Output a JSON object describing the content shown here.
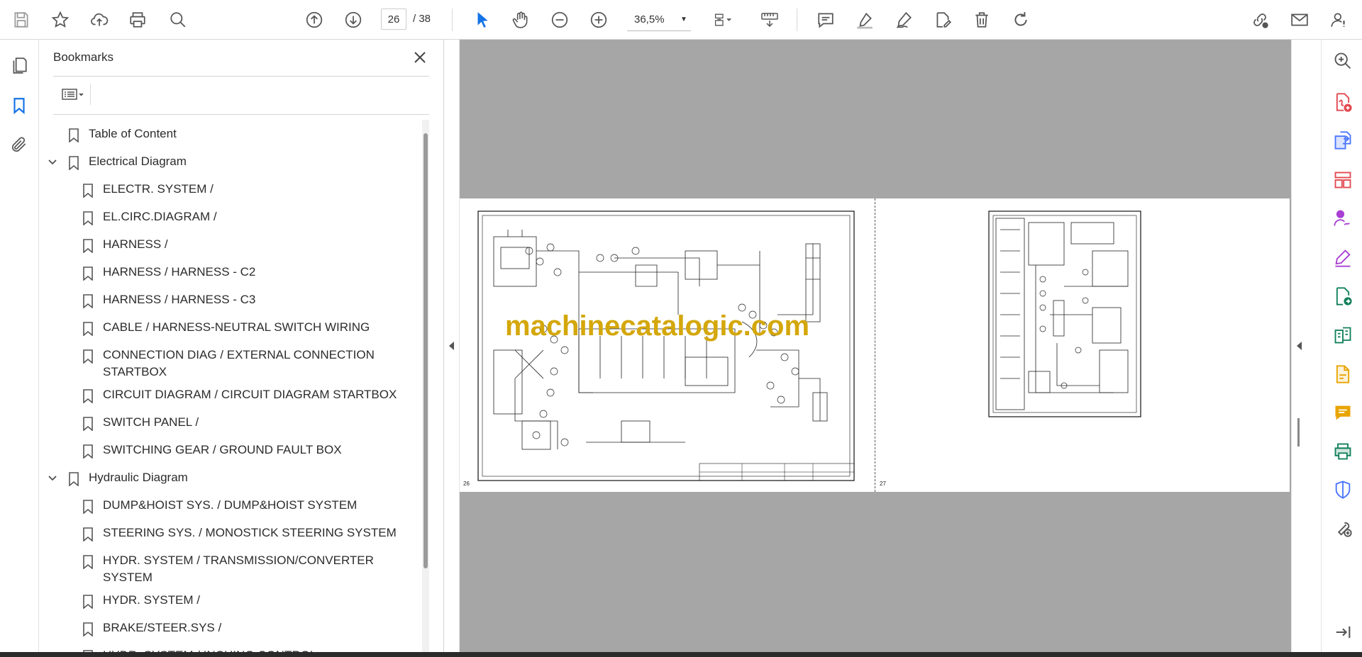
{
  "toolbar": {
    "page_current": "26",
    "page_total": "/ 38",
    "zoom": "36,5%"
  },
  "bookmarks": {
    "title": "Bookmarks",
    "items": [
      {
        "label": "Table of Content",
        "level": 0,
        "expandable": false
      },
      {
        "label": "Electrical Diagram",
        "level": 0,
        "expandable": true
      },
      {
        "label": "ELECTR. SYSTEM /",
        "level": 1
      },
      {
        "label": "EL.CIRC.DIAGRAM /",
        "level": 1
      },
      {
        "label": "HARNESS /",
        "level": 1
      },
      {
        "label": "HARNESS / HARNESS - C2",
        "level": 1
      },
      {
        "label": "HARNESS / HARNESS - C3",
        "level": 1
      },
      {
        "label": "CABLE / HARNESS-NEUTRAL SWITCH WIRING",
        "level": 1
      },
      {
        "label": "CONNECTION DIAG / EXTERNAL CONNECTION STARTBOX",
        "level": 1
      },
      {
        "label": "CIRCUIT DIAGRAM / CIRCUIT DIAGRAM STARTBOX",
        "level": 1
      },
      {
        "label": "SWITCH PANEL /",
        "level": 1
      },
      {
        "label": "SWITCHING GEAR / GROUND FAULT BOX",
        "level": 1
      },
      {
        "label": "Hydraulic Diagram",
        "level": 0,
        "expandable": true
      },
      {
        "label": "DUMP&HOIST SYS. / DUMP&HOIST SYSTEM",
        "level": 1
      },
      {
        "label": "STEERING SYS. / MONOSTICK STEERING SYSTEM",
        "level": 1
      },
      {
        "label": "HYDR. SYSTEM / TRANSMISSION/CONVERTER SYSTEM",
        "level": 1
      },
      {
        "label": "HYDR. SYSTEM /",
        "level": 1
      },
      {
        "label": "BRAKE/STEER.SYS /",
        "level": 1
      },
      {
        "label": "HYDR. SYSTEM / INCHING CONTROL",
        "level": 1
      }
    ]
  },
  "document": {
    "watermark": "machinecatalogic.com",
    "left_page_number": "26",
    "right_page_number": "27"
  },
  "colors": {
    "accent_blue": "#1473e6",
    "watermark": "#d4a70a",
    "doc_background": "#a6a6a6"
  }
}
